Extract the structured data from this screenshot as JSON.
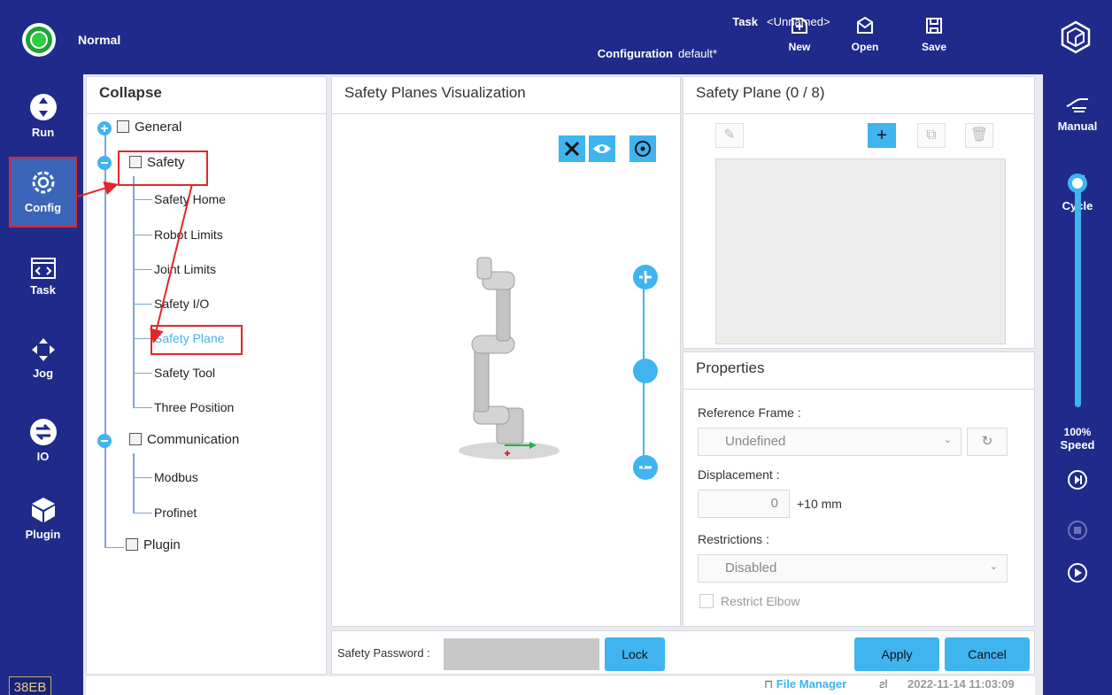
{
  "topbar": {
    "status": "Normal",
    "task_label": "Task",
    "task_value": "<Unnamed>",
    "config_label": "Configuration",
    "config_value": "default*",
    "new_label": "New",
    "open_label": "Open",
    "save_label": "Save"
  },
  "leftnav": {
    "items": [
      {
        "label": "Run",
        "icon": "run-icon"
      },
      {
        "label": "Config",
        "icon": "gear-icon"
      },
      {
        "label": "Task",
        "icon": "code-window-icon"
      },
      {
        "label": "Jog",
        "icon": "move-arrows-icon"
      },
      {
        "label": "IO",
        "icon": "io-icon"
      },
      {
        "label": "Plugin",
        "icon": "cube-icon"
      }
    ],
    "version": "38EB"
  },
  "rightnav": {
    "manual": "Manual",
    "cycle": "Cycle",
    "speed_value": "100%",
    "speed_label": "Speed",
    "speed_fraction": 1.0
  },
  "tree": {
    "title": "Collapse",
    "general": "General",
    "safety": "Safety",
    "safety_children": [
      "Safety Home",
      "Robot Limits",
      "Joint Limits",
      "Safety I/O",
      "Safety Plane",
      "Safety Tool",
      "Three Position"
    ],
    "communication": "Communication",
    "communication_children": [
      "Modbus",
      "Profinet"
    ],
    "plugin": "Plugin"
  },
  "viz": {
    "title": "Safety Planes Visualization"
  },
  "safety_plane": {
    "title": "Safety Plane (0 / 8)"
  },
  "properties": {
    "title": "Properties",
    "reference_frame_label": "Reference Frame :",
    "reference_frame_value": "Undefined",
    "displacement_label": "Displacement :",
    "displacement_value": "0",
    "displacement_step": "+10 mm",
    "restrictions_label": "Restrictions :",
    "restrictions_value": "Disabled",
    "restrict_elbow_label": "Restrict Elbow"
  },
  "bottom": {
    "password_label": "Safety Password :",
    "lock_label": "Lock",
    "apply_label": "Apply",
    "cancel_label": "Cancel"
  },
  "statusbar": {
    "file_manager": "File Manager",
    "timestamp": "2022-11-14 11:03:09"
  },
  "colors": {
    "primary": "#1f2a8a",
    "accent": "#3fb4ef",
    "highlight": "#e3262a",
    "status_ok": "#2ccd3e"
  }
}
